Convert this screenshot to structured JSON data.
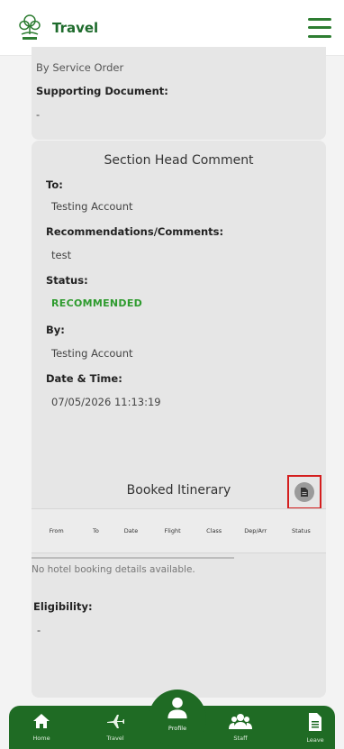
{
  "header": {
    "title": "Travel",
    "logo_icon": "tree-logo-icon",
    "menu_icon": "hamburger-menu-icon",
    "accent": "#2e7d32"
  },
  "top_card": {
    "approved_by": "By Service Order",
    "supporting_label": "Supporting Document:",
    "supporting_value": "-"
  },
  "section_head": {
    "title": "Section Head Comment",
    "to_label": "To:",
    "to_value": "Testing Account",
    "rec_label": "Recommendations/Comments:",
    "rec_value": "test",
    "status_label": "Status:",
    "status_value": "RECOMMENDED",
    "status_color": "#2e9b2e",
    "by_label": "By:",
    "by_value": "Testing Account",
    "datetime_label": "Date & Time:",
    "datetime_value": "07/05/2026 11:13:19"
  },
  "itinerary": {
    "title": "Booked Itinerary",
    "action_icon": "document-icon",
    "columns": [
      "From",
      "To",
      "Date",
      "Flight",
      "Class",
      "Dep/Arr",
      "Status"
    ],
    "no_hotel": "No hotel booking details available.",
    "eligibility_label": "Eligibility:",
    "eligibility_value": "-"
  },
  "nav": {
    "items": [
      {
        "label": "Home",
        "icon": "home-icon"
      },
      {
        "label": "Travel",
        "icon": "plane-icon"
      },
      {
        "label": "Profile",
        "icon": "person-icon"
      },
      {
        "label": "Staff",
        "icon": "group-icon"
      },
      {
        "label": "Leave",
        "icon": "file-icon"
      }
    ],
    "color": "#1f6b24"
  }
}
